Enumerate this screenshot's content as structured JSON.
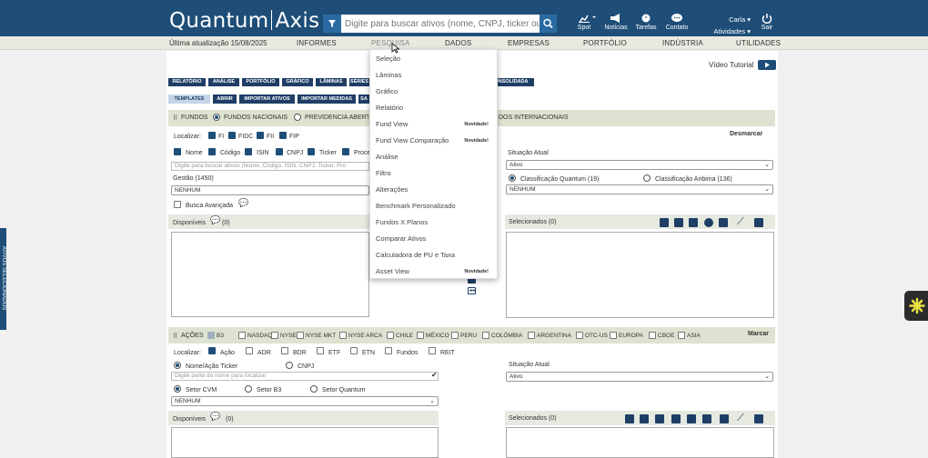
{
  "header": {
    "logo_left": "Quantum",
    "logo_right": "Axis",
    "search_placeholder": "Digite para buscar ativos (nome, CNPJ, ticker ou",
    "icons": [
      {
        "name": "spot",
        "label": "Spot"
      },
      {
        "name": "noticias",
        "label": "Notícias"
      },
      {
        "name": "tarefas",
        "label": "Tarefas"
      },
      {
        "name": "contato",
        "label": "Contato"
      }
    ],
    "user_name": "Carla",
    "user_menu": "Atividades",
    "logout": "Sair"
  },
  "nav": {
    "last_update": "Última atualização 15/08/2025",
    "items": [
      "INFORMES",
      "PESQUISA",
      "DADOS",
      "EMPRESAS",
      "PORTFÓLIO",
      "INDÚSTRIA",
      "UTILIDADES"
    ]
  },
  "sidebar_label": "ATIVOS SELECIONADOS",
  "video_tutorial": "Vídeo Tutorial",
  "tabs_top": [
    "RELATÓRIO",
    "ANÁLISE",
    "PORTFÓLIO",
    "GRÁFICO",
    "LÂMINAS",
    "SÉRIES",
    "CONSOLIDADA"
  ],
  "tabs_second": [
    "TEMPLATES",
    "ABRIR",
    "IMPORTAR ATIVOS",
    "IMPORTAR MEDIDAS",
    "SA"
  ],
  "fundos": {
    "title": "FUNDOS",
    "radio_nacionais": "FUNDOS NACIONAIS",
    "radio_previdencia": "PREVIDÊNCIA ABERTA",
    "radio_internacionais": "DOS INTERNACIONAIS",
    "localizar": "Localizar:",
    "loc_types": [
      "FI",
      "FIDC",
      "FII",
      "FIP"
    ],
    "desmarcar": "Desmarcar",
    "fields": [
      "Nome",
      "Código",
      "ISIN",
      "CNPJ",
      "Ticker",
      "Proce"
    ],
    "search_placeholder": "Digite para buscar ativos (Nome, Código, ISIN, CNPJ, Ticker, Pro",
    "gestao_label": "Gestão (1450)",
    "gestao_value": "NENHUM",
    "busca_avancada": "Busca Avançada",
    "situacao_label": "Situação Atual",
    "situacao_value": "Ativo",
    "class_quantum": "Classificação Quantum (19)",
    "class_anbima": "Classificação Anbima (136)",
    "class_value": "NENHUM",
    "disponiveis": "Disponíveis",
    "disponiveis_count": "(0)",
    "selecionados": "Selecionados (0)"
  },
  "dropdown": {
    "items": [
      {
        "label": "Seleção",
        "badge": ""
      },
      {
        "label": "Lâminas",
        "badge": ""
      },
      {
        "label": "Gráfico",
        "badge": ""
      },
      {
        "label": "Relatório",
        "badge": ""
      },
      {
        "label": "Fund View",
        "badge": "Novidade!"
      },
      {
        "label": "Fund View Comparação",
        "badge": "Novidade!"
      },
      {
        "label": "Análise",
        "badge": ""
      },
      {
        "label": "Filtro",
        "badge": ""
      },
      {
        "label": "Alterações",
        "badge": ""
      },
      {
        "label": "Benchmark Personalizado",
        "badge": ""
      },
      {
        "label": "Fundos X Planos",
        "badge": ""
      },
      {
        "label": "Comparar Ativos",
        "badge": ""
      },
      {
        "label": "Calculadora de PU e Taxa",
        "badge": ""
      },
      {
        "label": "Asset View",
        "badge": "Novidade!"
      }
    ]
  },
  "acoes": {
    "title": "AÇÕES",
    "markets": [
      "B3",
      "NASDAQ",
      "NYSE",
      "NYSE MKT",
      "NYSE ARCA",
      "CHILE",
      "MÉXICO",
      "PERU",
      "COLÔMBIA",
      "ARGENTINA",
      "OTC-US",
      "EUROPA",
      "CBOE",
      "ASIA"
    ],
    "marcar": "Marcar",
    "localizar": "Localizar:",
    "loc_types": [
      "Ação",
      "ADR",
      "BDR",
      "ETF",
      "ETN",
      "Fundos",
      "REIT"
    ],
    "radio_nome": "Nome/Ação Ticker",
    "radio_cnpj": "CNPJ",
    "search_placeholder": "Digite parte do nome para localizar",
    "setor_cvm": "Setor CVM",
    "setor_b3": "Setor B3",
    "setor_quantum": "Setor Quantum",
    "setor_value": "NENHUM",
    "situacao_label": "Situação Atual",
    "situacao_value": "Ativo",
    "disponiveis": "Disponíveis",
    "disponiveis_count": "(0)",
    "selecionados": "Selecionados (0)"
  }
}
